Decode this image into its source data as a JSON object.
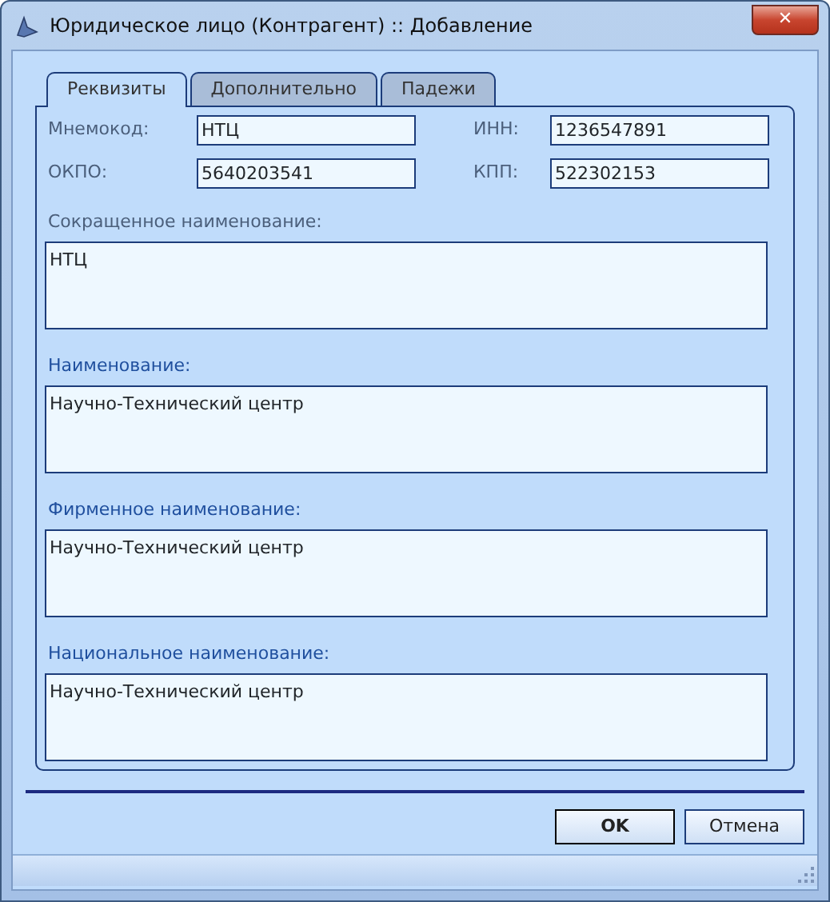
{
  "window": {
    "title": "Юридическое лицо (Контрагент) :: Добавление",
    "close": "✕"
  },
  "tabs": [
    {
      "label": "Реквизиты",
      "selected": true
    },
    {
      "label": "Дополнительно",
      "selected": false
    },
    {
      "label": "Падежи",
      "selected": false
    }
  ],
  "fields": [
    {
      "label": "Мнемокод:",
      "value": "НТЦ"
    },
    {
      "label": "ИНН:",
      "value": "1236547891"
    },
    {
      "label": "ОКПО:",
      "value": "5640203541"
    },
    {
      "label": "КПП:",
      "value": "522302153"
    }
  ],
  "names": [
    {
      "label": "Сокращенное наименование:",
      "value": "НТЦ",
      "required": false
    },
    {
      "label": "Наименование:",
      "value": "Научно-Технический центр",
      "required": true
    },
    {
      "label": "Фирменное наименование:",
      "value": "Научно-Технический центр",
      "required": true
    },
    {
      "label": "Национальное наименование:",
      "value": "Научно-Технический центр",
      "required": true
    }
  ],
  "buttons": [
    {
      "label": "OK",
      "default": true
    },
    {
      "label": "Отмена",
      "default": false
    }
  ]
}
